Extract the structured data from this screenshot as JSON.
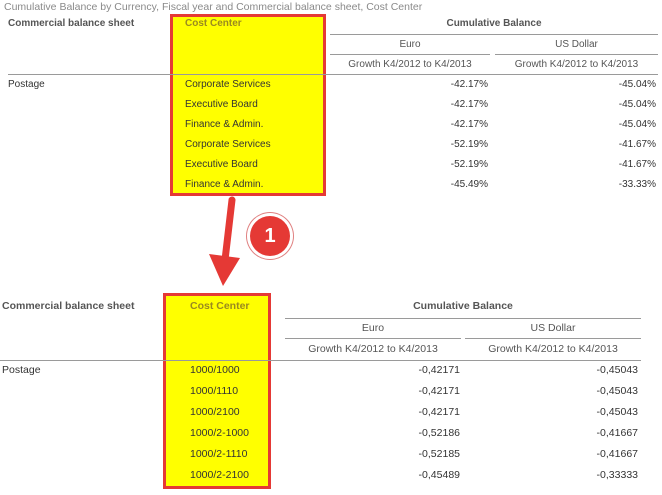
{
  "caption": "Cumulative Balance by Currency, Fiscal year and Commercial balance sheet, Cost Center",
  "callout": "1",
  "colors": {
    "highlight": "#ffff00",
    "highlight_border": "#e53935",
    "arrow": "#e53935"
  },
  "top_table": {
    "col_balance_sheet": "Commercial balance sheet",
    "col_cost_center": "Cost Center",
    "col_cumulative": "Cumulative Balance",
    "currency_euro": "Euro",
    "currency_usd": "US Dollar",
    "growth_euro": "Growth K4/2012 to K4/2013",
    "growth_usd": "Growth K4/2012 to K4/2013",
    "row_label": "Postage",
    "rows": [
      {
        "cc": "Corporate Services",
        "euro": "-42.17%",
        "usd": "-45.04%"
      },
      {
        "cc": "Executive Board",
        "euro": "-42.17%",
        "usd": "-45.04%"
      },
      {
        "cc": "Finance & Admin.",
        "euro": "-42.17%",
        "usd": "-45.04%"
      },
      {
        "cc": "Corporate Services",
        "euro": "-52.19%",
        "usd": "-41.67%"
      },
      {
        "cc": "Executive Board",
        "euro": "-52.19%",
        "usd": "-41.67%"
      },
      {
        "cc": "Finance & Admin.",
        "euro": "-45.49%",
        "usd": "-33.33%"
      }
    ]
  },
  "bottom_table": {
    "col_balance_sheet": "Commercial balance sheet",
    "col_cost_center": "Cost Center",
    "col_cumulative": "Cumulative Balance",
    "currency_euro": "Euro",
    "currency_usd": "US Dollar",
    "growth_euro": "Growth K4/2012 to K4/2013",
    "growth_usd": "Growth K4/2012 to K4/2013",
    "row_label": "Postage",
    "rows": [
      {
        "cc": "1000/1000",
        "euro": "-0,42171",
        "usd": "-0,45043"
      },
      {
        "cc": "1000/1110",
        "euro": "-0,42171",
        "usd": "-0,45043"
      },
      {
        "cc": "1000/2100",
        "euro": "-0,42171",
        "usd": "-0,45043"
      },
      {
        "cc": "1000/2-1000",
        "euro": "-0,52186",
        "usd": "-0,41667"
      },
      {
        "cc": "1000/2-1110",
        "euro": "-0,52185",
        "usd": "-0,41667"
      },
      {
        "cc": "1000/2-2100",
        "euro": "-0,45489",
        "usd": "-0,33333"
      }
    ]
  }
}
